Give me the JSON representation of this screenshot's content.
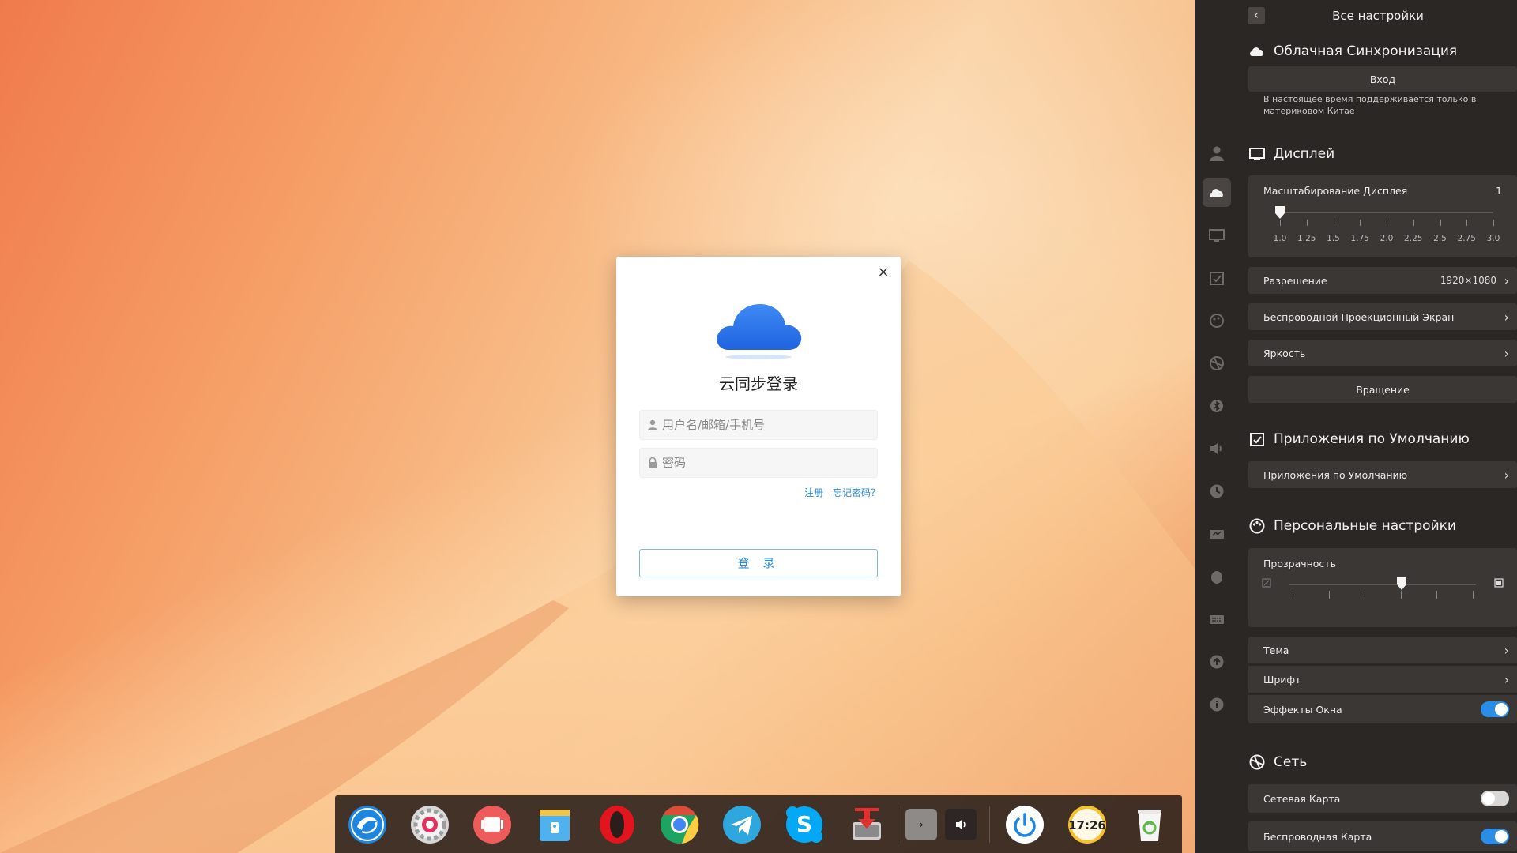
{
  "dialog": {
    "title": "云同步登录",
    "username_placeholder": "用户名/邮箱/手机号",
    "password_placeholder": "密码",
    "register_link": "注册",
    "forgot_link": "忘记密码？",
    "login_button": "登 录",
    "close_glyph": "×"
  },
  "settings": {
    "title": "Все настройки",
    "back_glyph": "‹",
    "cloud": {
      "heading": "Облачная Синхронизация",
      "login_button": "Вход",
      "note": "В настоящее время поддерживается только в материковом Китае"
    },
    "display": {
      "heading": "Дисплей",
      "scaling_label": "Масштабирование Дисплея",
      "scaling_value": "1",
      "scaling_ticks": [
        "1.0",
        "1.25",
        "1.5",
        "1.75",
        "2.0",
        "2.25",
        "2.5",
        "2.75",
        "3.0"
      ],
      "resolution_label": "Разрешение",
      "resolution_value": "1920×1080",
      "wireless_label": "Беспроводной Проекционный Экран",
      "brightness_label": "Яркость",
      "rotation_label": "Вращение"
    },
    "default_apps": {
      "heading": "Приложения по Умолчанию",
      "item_label": "Приложения по Умолчанию"
    },
    "personal": {
      "heading": "Персональные настройки",
      "transparency_label": "Прозрачность",
      "transparency_level": 0.6,
      "theme_label": "Тема",
      "font_label": "Шрифт",
      "effects_label": "Эффекты Окна",
      "effects_on": true
    },
    "network": {
      "heading": "Сеть",
      "wired_label": "Сетевая Карта",
      "wired_on": false,
      "wireless_label": "Беспроводная Карта",
      "wireless_on": true
    }
  },
  "dock": {
    "clock_text": "17:26",
    "items": [
      "launcher-icon",
      "settings-icon",
      "screen-recorder-icon",
      "file-manager-icon",
      "opera-icon",
      "chrome-icon",
      "telegram-icon",
      "skype-icon",
      "installer-icon",
      "tray-expand-icon",
      "volume-icon",
      "power-icon",
      "clock-icon",
      "trash-icon"
    ]
  },
  "colors": {
    "accent": "#2b8de6",
    "panel_bg": "#2b2725",
    "row_bg": "#3b3734"
  }
}
